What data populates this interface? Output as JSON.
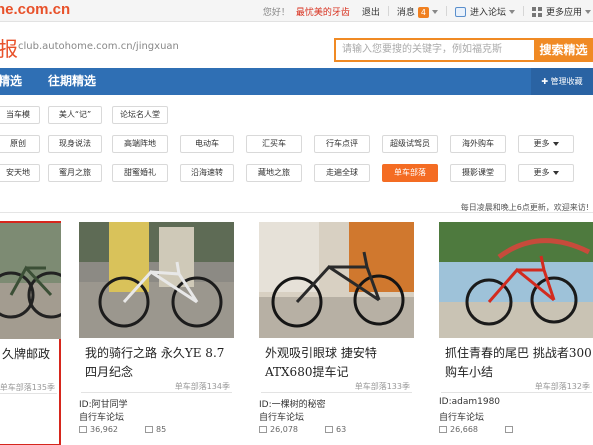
{
  "topbar": {
    "logo_domain": "ne.com.cn",
    "greeting": "您好！",
    "username": "最忧美的牙齿",
    "logout": "退出",
    "messages_label": "消息",
    "messages_count": "4",
    "forum_entry": "进入论坛",
    "more_apps": "更多应用"
  },
  "header": {
    "brand_fragment": "报",
    "site_url": "club.autohome.com.cn/jingxuan",
    "search_placeholder": "请输入您要搜的关键字，例如福克斯",
    "search_button": "搜索精选"
  },
  "nav": {
    "items": [
      "精选",
      "往期精选"
    ],
    "manage_label": "管理收藏"
  },
  "tags": {
    "row1": [
      "当车模",
      "美人“记”",
      "论坛名人堂"
    ],
    "row2": [
      "原创",
      "现身说法",
      "高端阵地",
      "电动车",
      "汇买车",
      "行车点评",
      "超级试驾员",
      "海外购车",
      "更多"
    ],
    "row3": [
      "安天地",
      "蜜月之旅",
      "甜蜜婚礼",
      "沿海速转",
      "藏地之旅",
      "走遍全球",
      "单车部落",
      "摄影课堂",
      "更多"
    ],
    "active_tag": "单车部落"
  },
  "notice": "每日凌晨和晚上6点更新，欢迎来访!",
  "cards": [
    {
      "title": "久牌邮政",
      "board": "单车部落135季",
      "author": "",
      "forum": "",
      "views": "",
      "replies": "",
      "highlighted": true
    },
    {
      "title": "我的骑行之路 永久YE 8.7四月纪念",
      "board": "单车部落134季",
      "author": "ID:阿甘同学",
      "forum": "自行车论坛",
      "views": "36,962",
      "replies": "85",
      "highlighted": false
    },
    {
      "title": "外观吸引眼球 捷安特ATX680提车记",
      "board": "单车部落133季",
      "author": "ID:一棵树的秘密",
      "forum": "自行车论坛",
      "views": "26,078",
      "replies": "63",
      "highlighted": false
    },
    {
      "title": "抓住青春的尾巴 挑战者300购车小结",
      "board": "单车部落132季",
      "author": "ID:adam1980",
      "forum": "自行车论坛",
      "views": "26,668",
      "replies": "",
      "highlighted": false
    }
  ],
  "colors": {
    "brand_orange": "#f08a24",
    "nav_blue": "#2f6fb4",
    "active_tag": "#f46c23",
    "highlight_border": "#d6261c"
  }
}
